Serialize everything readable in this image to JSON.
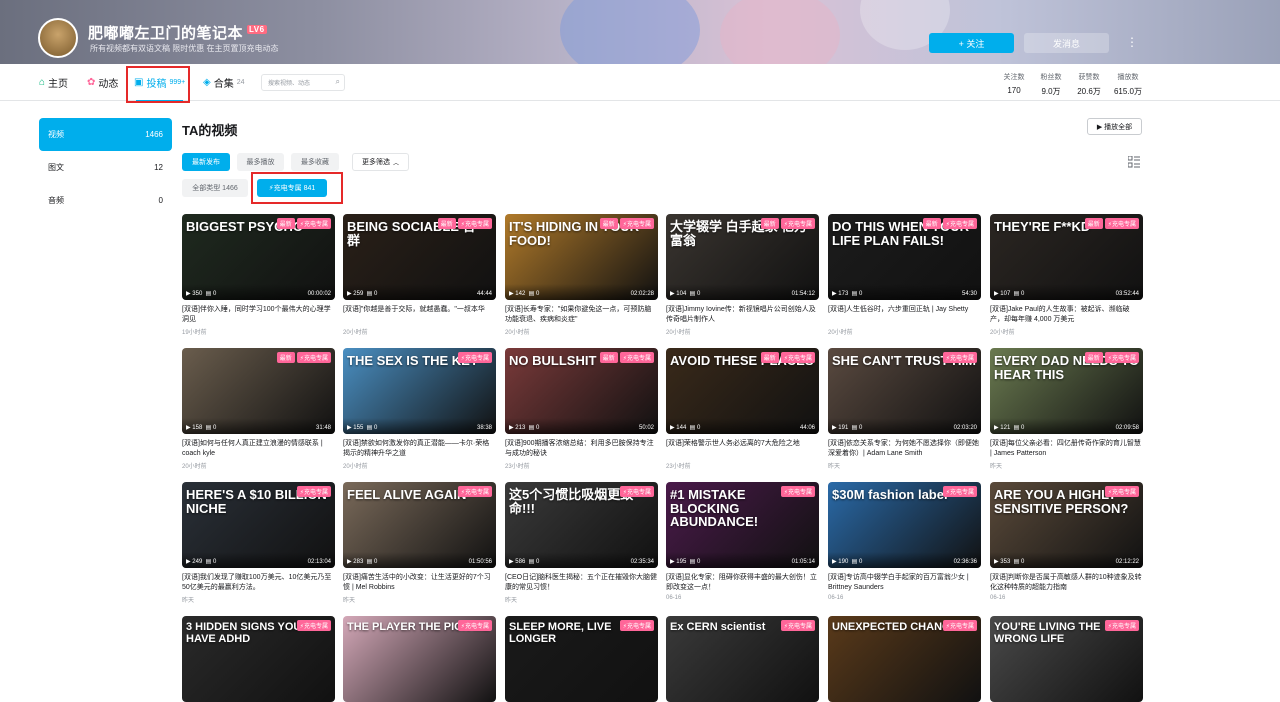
{
  "header": {
    "username": "肥嘟嘟左卫门的笔记本",
    "level": "LV6",
    "signature": "所有视频都有双语文稿 限时优惠 在主页置顶充电动态",
    "follow_label": "+ 关注",
    "message_label": "发消息",
    "more_label": "⋮"
  },
  "nav": {
    "home": "主页",
    "dynamic": "动态",
    "uploads": "投稿",
    "uploads_count": "999+",
    "collections": "合集",
    "collections_count": "24",
    "search_placeholder": "搜索视频、动态"
  },
  "stats": [
    {
      "label": "关注数",
      "value": "170"
    },
    {
      "label": "粉丝数",
      "value": "9.0万"
    },
    {
      "label": "获赞数",
      "value": "20.6万"
    },
    {
      "label": "播放数",
      "value": "615.0万"
    }
  ],
  "sidebar": {
    "items": [
      {
        "label": "视频",
        "count": "1466"
      },
      {
        "label": "图文",
        "count": "12"
      },
      {
        "label": "音频",
        "count": "0"
      }
    ]
  },
  "main": {
    "title": "TA的视频",
    "play_all": "▶ 播放全部",
    "sort": [
      "最新发布",
      "最多播放",
      "最多收藏"
    ],
    "more_filter": "更多筛选",
    "types": [
      "全部类型 1466",
      "⚡充电专属 841"
    ]
  },
  "badge": {
    "new": "最新",
    "charge": "⚡充电专属"
  },
  "colors": {
    "accent": "#00aeec",
    "pink": "#ff6699",
    "highlight": "#e52929"
  },
  "videos": [
    {
      "overlay": "BIGGEST PSYCHO",
      "plays": "350",
      "danmaku": "0",
      "duration": "00:00:02",
      "title": "[双语]伴你入睡，同时学习100个最伟大的心理学洞见",
      "date": "19小时前",
      "new": true,
      "bg": "#1f2a1f"
    },
    {
      "overlay": "BEING SOCIABLE 合 群",
      "plays": "259",
      "danmaku": "0",
      "duration": "44:44",
      "title": "[双语]\"你越是善于交际，就越愚蠢。\"一叔本华",
      "date": "20小时前",
      "new": true,
      "bg": "#2a2018"
    },
    {
      "overlay": "IT'S HIDING IN YOUR FOOD!",
      "plays": "142",
      "danmaku": "0",
      "duration": "02:02:28",
      "title": "[双语]长寿专家：\"如果你避免这一点，可预防脑功能衰退、疾病和炎症\"",
      "date": "20小时前",
      "new": true,
      "bg": "#b07a2a"
    },
    {
      "overlay": "大学辍学 白手起家 亿万富翁",
      "plays": "104",
      "danmaku": "0",
      "duration": "01:54:12",
      "title": "[双语]Jimmy Iovine传：新视镜唱片公司创始人及传奇唱片制作人",
      "date": "20小时前",
      "new": true,
      "bg": "#3a3530"
    },
    {
      "overlay": "DO THIS WHEN YOUR LIFE PLAN FAILS!",
      "plays": "173",
      "danmaku": "0",
      "duration": "54:30",
      "title": "[双语]人生低谷时，六步重回正轨 | Jay Shetty",
      "date": "20小时前",
      "new": true,
      "bg": "#1c1c1c"
    },
    {
      "overlay": "THEY'RE F**KD",
      "plays": "107",
      "danmaku": "0",
      "duration": "03:52:44",
      "title": "[双语]Jake Paul的人生故事：被起诉、濒临破产，却每年赚 4,000 万美元",
      "date": "20小时前",
      "new": true,
      "bg": "#2b2622"
    },
    {
      "overlay": "",
      "plays": "158",
      "danmaku": "0",
      "duration": "31:48",
      "title": "[双语]如何与任何人真正建立浪漫的情感联系 | coach kyle",
      "date": "20小时前",
      "new": true,
      "bg": "#6a5d4d"
    },
    {
      "overlay": "THE SEX IS THE KEY",
      "plays": "155",
      "danmaku": "0",
      "duration": "38:38",
      "title": "[双语]禁欲如何激发你的真正潜能——卡尔·荣格揭示的精神升华之道",
      "date": "20小时前",
      "new": false,
      "bg": "#4a8fc2"
    },
    {
      "overlay": "NO BULLSHIT",
      "plays": "213",
      "danmaku": "0",
      "duration": "50:02",
      "title": "[双语]900期播客浓缩总结：利用多巴胺保持专注与成功的秘诀",
      "date": "23小时前",
      "new": true,
      "bg": "#7a3a3a"
    },
    {
      "overlay": "AVOID THESE PLACES",
      "plays": "144",
      "danmaku": "0",
      "duration": "44:06",
      "title": "[双语]荣格警示世人务必远离的7大危险之地",
      "date": "23小时前",
      "new": true,
      "bg": "#3a2a1a"
    },
    {
      "overlay": "SHE CAN'T TRUST HIM",
      "plays": "191",
      "danmaku": "0",
      "duration": "02:03:20",
      "title": "[双语]依恋关系专家：为何她不愿选择你（即便她深爱着你）| Adam Lane Smith",
      "date": "昨天",
      "new": false,
      "bg": "#5a4a40"
    },
    {
      "overlay": "EVERY DAD NEEDS TO HEAR THIS",
      "plays": "121",
      "danmaku": "0",
      "duration": "02:09:58",
      "title": "[双语]每位父亲必看：四亿册传奇作家的育儿智慧 | James Patterson",
      "date": "昨天",
      "new": true,
      "bg": "#6a7a50"
    },
    {
      "overlay": "HERE'S A $10 BILLION NICHE",
      "plays": "249",
      "danmaku": "0",
      "duration": "02:13:04",
      "title": "[双语]我们发现了赚取100万美元、10亿美元乃至50亿美元的最赢利方法。",
      "date": "昨天",
      "new": false,
      "bg": "#2a3038"
    },
    {
      "overlay": "FEEL ALIVE AGAIN",
      "plays": "283",
      "danmaku": "0",
      "duration": "01:50:56",
      "title": "[双语]痛苦生活中的小改变：让生活更好的7个习惯 | Mel Robbins",
      "date": "昨天",
      "new": false,
      "bg": "#7a6a5a"
    },
    {
      "overlay": "这5个习惯比吸烟更致命!!!",
      "plays": "586",
      "danmaku": "0",
      "duration": "02:35:34",
      "title": "[CEO日记]脑科医生揭秘：五个正在摧毁你大脑健康的常见习惯！",
      "date": "昨天",
      "new": false,
      "bg": "#3a3a3a"
    },
    {
      "overlay": "#1 MISTAKE BLOCKING ABUNDANCE!",
      "plays": "195",
      "danmaku": "0",
      "duration": "01:05:14",
      "title": "[双语]显化专家：阻碍你获得丰盛的最大创伤！立即改变这一点！",
      "date": "06-16",
      "new": false,
      "bg": "#4a1a4a"
    },
    {
      "overlay": "$30M fashion label",
      "plays": "190",
      "danmaku": "0",
      "duration": "02:36:36",
      "title": "[双语]专访高中辍学白手起家的百万富翁少女 | Brittney Saunders",
      "date": "06-16",
      "new": false,
      "bg": "#2a6aa8"
    },
    {
      "overlay": "ARE YOU A HIGHLY SENSITIVE PERSON?",
      "plays": "353",
      "danmaku": "0",
      "duration": "02:12:22",
      "title": "[双语]判断你是否属于高敏感人群的10种迹象及转化这种特质的超能力指南",
      "date": "06-16",
      "new": false,
      "bg": "#5a4a3a"
    },
    {
      "overlay": "3 HIDDEN SIGNS YOU HAVE ADHD",
      "plays": "",
      "danmaku": "",
      "duration": "",
      "title": "",
      "date": "",
      "new": false,
      "bg": "#2a2a2a"
    },
    {
      "overlay": "THE PLAYER  THE PICK ME",
      "plays": "",
      "danmaku": "",
      "duration": "",
      "title": "",
      "date": "",
      "new": false,
      "bg": "#d4a8b8"
    },
    {
      "overlay": "SLEEP MORE, LIVE LONGER",
      "plays": "",
      "danmaku": "",
      "duration": "",
      "title": "",
      "date": "",
      "new": false,
      "bg": "#1a1a1a"
    },
    {
      "overlay": "Ex CERN scientist",
      "plays": "",
      "danmaku": "",
      "duration": "",
      "title": "",
      "date": "",
      "new": false,
      "bg": "#3a3a3a"
    },
    {
      "overlay": "UNEXPECTED CHANGE",
      "plays": "",
      "danmaku": "",
      "duration": "",
      "title": "",
      "date": "",
      "new": false,
      "bg": "#5a3a1a"
    },
    {
      "overlay": "YOU'RE LIVING THE WRONG LIFE",
      "plays": "",
      "danmaku": "",
      "duration": "",
      "title": "",
      "date": "",
      "new": false,
      "bg": "#4a4a4a"
    }
  ]
}
